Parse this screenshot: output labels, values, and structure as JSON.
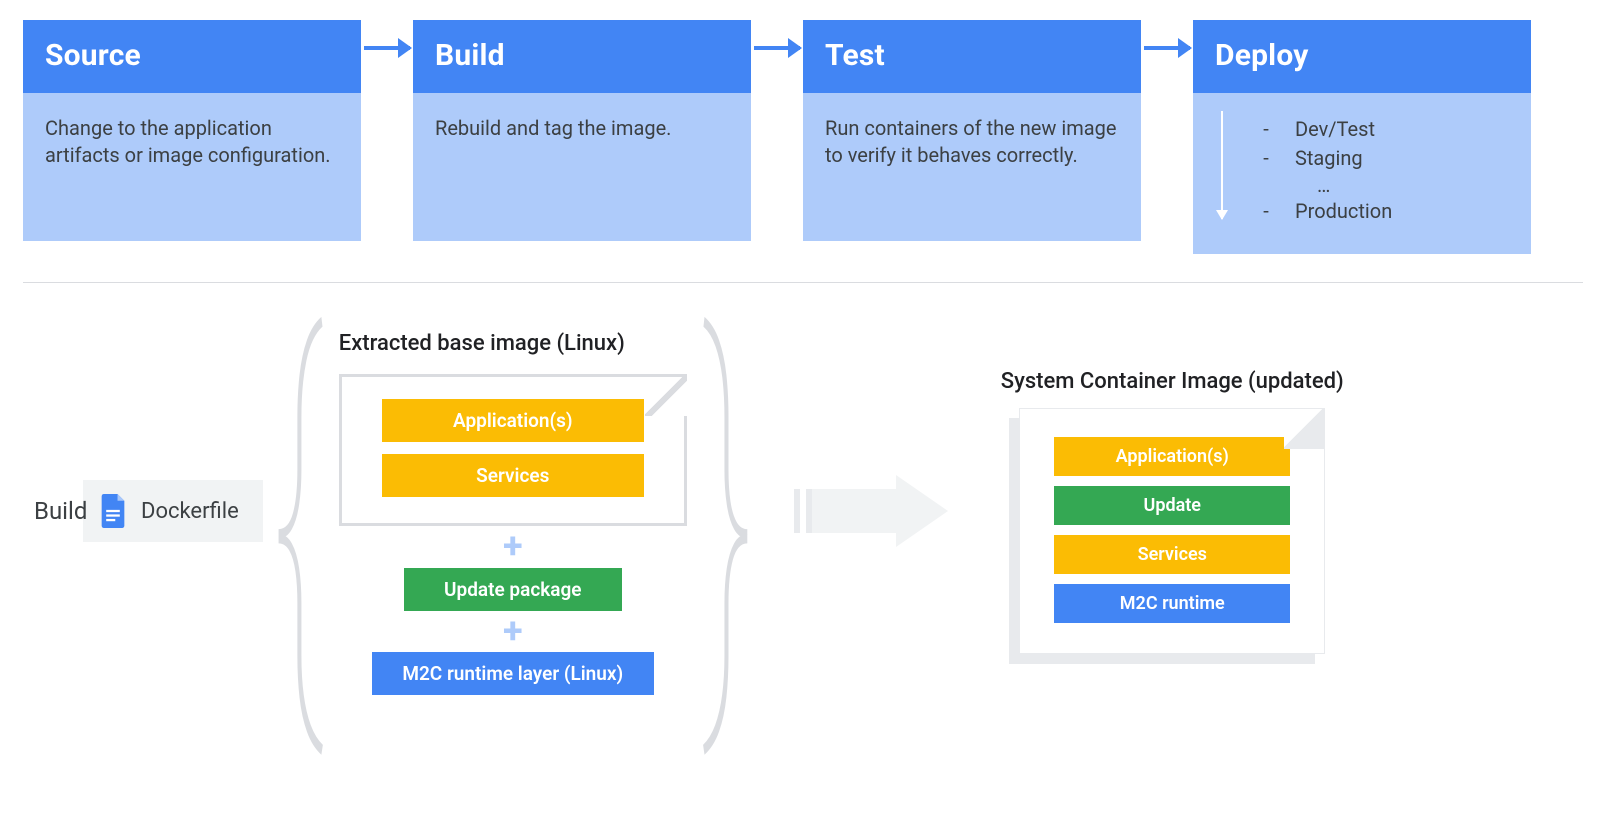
{
  "pipeline": {
    "stages": [
      {
        "title": "Source",
        "body": "Change to the application artifacts or image configuration."
      },
      {
        "title": "Build",
        "body": "Rebuild and tag the image."
      },
      {
        "title": "Test",
        "body": "Run containers of the new image to verify it behaves correctly."
      },
      {
        "title": "Deploy",
        "items": [
          "Dev/Test",
          "Staging",
          "Production"
        ],
        "ellipsis": "…"
      }
    ]
  },
  "lower": {
    "dockerfile_label": "Dockerfile",
    "extracted_title": "Extracted base image (Linux)",
    "base_image_layers": [
      "Application(s)",
      "Services"
    ],
    "update_package": "Update package",
    "runtime_layer": "M2C runtime layer (Linux)",
    "build_label": "Build",
    "result_title": "System Container Image (updated)",
    "result_layers": [
      {
        "text": "Application(s)",
        "color": "yellow"
      },
      {
        "text": "Update",
        "color": "green"
      },
      {
        "text": "Services",
        "color": "yellow"
      },
      {
        "text": "M2C runtime",
        "color": "blue"
      }
    ]
  },
  "colors": {
    "primary_blue": "#4285f4",
    "light_blue": "#aecbfa",
    "yellow": "#fbbc04",
    "green": "#34a853",
    "grey": "#f1f3f4"
  }
}
